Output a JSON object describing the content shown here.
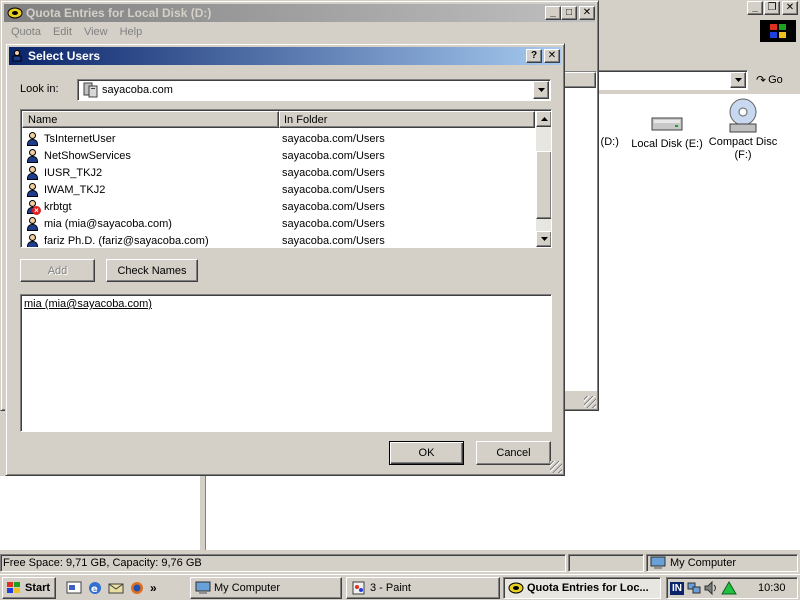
{
  "desktop_window": {
    "address_go": "Go",
    "drives": [
      {
        "partial_label": "k (D:)"
      },
      {
        "label": "Local Disk (E:)"
      },
      {
        "label": "Compact Disc (F:)"
      }
    ]
  },
  "status_bar": {
    "free_space": "Free Space: 9,71 GB, Capacity: 9,76 GB",
    "location": "My Computer"
  },
  "quota_window": {
    "title": "Quota Entries for Local Disk (D:)",
    "menu": [
      "Quota",
      "Edit",
      "View",
      "Help"
    ]
  },
  "dialog": {
    "title": "Select Users",
    "look_in_label": "Look in:",
    "look_in_value": "sayacoba.com",
    "columns": [
      "Name",
      "In Folder"
    ],
    "rows": [
      {
        "name": "TsInternetUser",
        "folder": "sayacoba.com/Users",
        "icon": "user-icon"
      },
      {
        "name": "NetShowServices",
        "folder": "sayacoba.com/Users",
        "icon": "user-icon"
      },
      {
        "name": "IUSR_TKJ2",
        "folder": "sayacoba.com/Users",
        "icon": "user-icon"
      },
      {
        "name": "IWAM_TKJ2",
        "folder": "sayacoba.com/Users",
        "icon": "user-icon"
      },
      {
        "name": "krbtgt",
        "folder": "sayacoba.com/Users",
        "icon": "disabled-user-icon"
      },
      {
        "name": "mia (mia@sayacoba.com)",
        "folder": "sayacoba.com/Users",
        "icon": "user-icon"
      },
      {
        "name": "fariz Ph.D. (fariz@sayacoba.com)",
        "folder": "sayacoba.com/Users",
        "icon": "user-icon"
      }
    ],
    "add_label": "Add",
    "check_names_label": "Check Names",
    "selected_text": "mia (mia@sayacoba.com)",
    "ok_label": "OK",
    "cancel_label": "Cancel"
  },
  "taskbar": {
    "start_label": "Start",
    "quicklaunch_more": "»",
    "tasks": [
      {
        "label": "My Computer"
      },
      {
        "label": "3 - Paint"
      },
      {
        "label": "Quota Entries for Loc..."
      }
    ],
    "lang": "IN",
    "clock": "10:30"
  }
}
